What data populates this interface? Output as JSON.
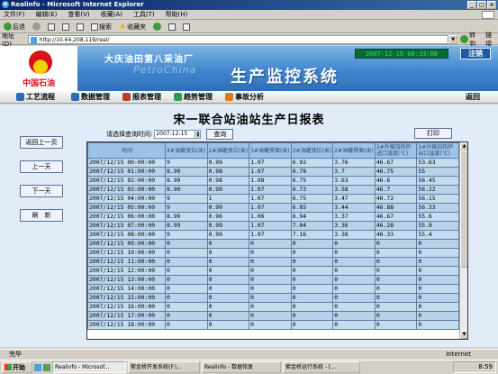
{
  "window": {
    "title": "Realinfo - Microsoft Internet Explorer",
    "title_prefix": "Realinfo - Microsoft Internet Explorer"
  },
  "menu": [
    "文件(F)",
    "编辑(E)",
    "查看(V)",
    "收藏(A)",
    "工具(T)",
    "帮助(H)"
  ],
  "toolbar": {
    "back_label": "后退",
    "search_label": "搜索",
    "favorites_label": "收藏夹"
  },
  "address": {
    "label": "地址(D)",
    "url": "http://10.64.208.119/real/",
    "go_label": "转到",
    "links_label": "链接"
  },
  "banner": {
    "logo_text": "中国石油",
    "subtitle": "大庆油田第八采油厂",
    "petro_text": "PetroChina",
    "title": "生产监控系统",
    "clock": "2007-12-15 08:33:08",
    "logout_label": "注销"
  },
  "nav": {
    "items": [
      {
        "label": "工艺流程",
        "color": "#2a6cb6"
      },
      {
        "label": "数据管理",
        "color": "#2a6cb6"
      },
      {
        "label": "报表管理",
        "color": "#c23a2a"
      },
      {
        "label": "趋势管理",
        "color": "#2aa04a"
      },
      {
        "label": "事故分析",
        "color": "#e07a1a"
      }
    ],
    "back_label": "返回"
  },
  "report": {
    "title": "宋一联合站油站生产日报表",
    "side_buttons": [
      "返回上一页",
      "上一天",
      "下一天",
      "刷　新"
    ],
    "query_label": "请选择查询时间:",
    "query_date": "2007-12-15",
    "query_button": "查询",
    "print_button": "打印",
    "columns": [
      "时间",
      "4#油罐液位(米)",
      "2#油罐液位(米)",
      "3#油罐界面(米)",
      "2#油罐液位(米)",
      "2#油罐界面(米)",
      "2#外输加热炉进口温度(℃)",
      "2#外输加热炉出口温度(℃)"
    ],
    "rows": [
      [
        "2007/12/15 00:00:00",
        "9",
        "0.99",
        "1.07",
        "6.92",
        "3.76",
        "46.67",
        "53.63"
      ],
      [
        "2007/12/15 01:00:00",
        "8.99",
        "0.98",
        "1.07",
        "6.78",
        "3.7",
        "46.75",
        "55"
      ],
      [
        "2007/12/15 02:00:00",
        "8.99",
        "0.98",
        "1.08",
        "6.75",
        "3.63",
        "46.6",
        "56.45"
      ],
      [
        "2007/12/15 03:00:00",
        "8.99",
        "0.99",
        "1.07",
        "6.73",
        "3.58",
        "46.7",
        "56.22"
      ],
      [
        "2007/12/15 04:00:00",
        "9",
        "1",
        "1.07",
        "6.75",
        "3.47",
        "46.72",
        "56.15"
      ],
      [
        "2007/12/15 05:00:00",
        "9",
        "0.99",
        "1.07",
        "6.85",
        "3.44",
        "46.88",
        "56.33"
      ],
      [
        "2007/12/15 06:00:00",
        "8.99",
        "0.96",
        "1.06",
        "6.94",
        "3.37",
        "46.67",
        "55.6"
      ],
      [
        "2007/12/15 07:00:00",
        "8.99",
        "0.99",
        "1.07",
        "7.04",
        "3.36",
        "46.28",
        "55.9"
      ],
      [
        "2007/12/15 08:00:00",
        "9",
        "0.99",
        "1.07",
        "7.16",
        "3.38",
        "46.33",
        "55.4"
      ],
      [
        "2007/12/15 09:00:00",
        "0",
        "0",
        "0",
        "0",
        "0",
        "0",
        "0"
      ],
      [
        "2007/12/15 10:00:00",
        "0",
        "0",
        "0",
        "0",
        "0",
        "0",
        "0"
      ],
      [
        "2007/12/15 11:00:00",
        "0",
        "0",
        "0",
        "0",
        "0",
        "0",
        "0"
      ],
      [
        "2007/12/15 12:00:00",
        "0",
        "0",
        "0",
        "0",
        "0",
        "0",
        "0"
      ],
      [
        "2007/12/15 13:00:00",
        "0",
        "0",
        "0",
        "0",
        "0",
        "0",
        "0"
      ],
      [
        "2007/12/15 14:00:00",
        "0",
        "0",
        "0",
        "0",
        "0",
        "0",
        "0"
      ],
      [
        "2007/12/15 15:00:00",
        "0",
        "0",
        "0",
        "0",
        "0",
        "0",
        "0"
      ],
      [
        "2007/12/15 16:00:00",
        "0",
        "0",
        "0",
        "0",
        "0",
        "0",
        "0"
      ],
      [
        "2007/12/15 17:00:00",
        "0",
        "0",
        "0",
        "0",
        "0",
        "0",
        "0"
      ],
      [
        "2007/12/15 18:00:00",
        "0",
        "0",
        "0",
        "0",
        "0",
        "0",
        "0"
      ]
    ]
  },
  "status": {
    "left": "完毕",
    "zone": "Internet"
  },
  "taskbar": {
    "start_label": "开始",
    "tasks": [
      {
        "label": "Realinfo - Microsof...",
        "active": true
      },
      {
        "label": "紫金桥开发系统(F:\\..."
      },
      {
        "label": "Realinfo - 数据恢复"
      },
      {
        "label": "紫金桥运行系统 - [..."
      }
    ],
    "clock": "8:59"
  }
}
